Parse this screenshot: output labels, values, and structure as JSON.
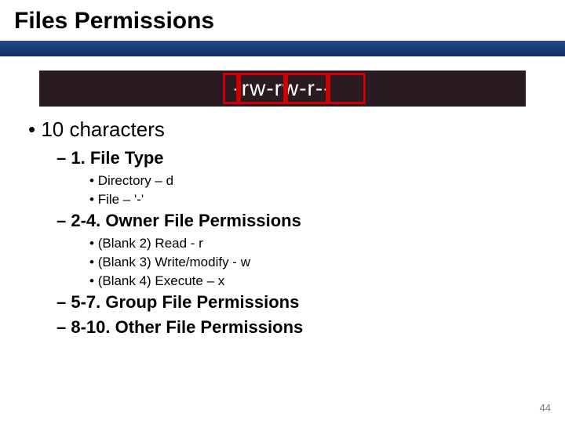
{
  "title": "Files Permissions",
  "perm_string": "-rw-rw-r--",
  "bullets": {
    "l1_1": "10 characters",
    "l2_1": "1. File Type",
    "l3_1a": "Directory – d",
    "l3_1b": "File – '-'",
    "l2_2": "2-4. Owner File Permissions",
    "l3_2a": "(Blank 2) Read - r",
    "l3_2b": "(Blank 3) Write/modify - w",
    "l3_2c": "(Blank 4) Execute – x",
    "l2_3": "5-7. Group File Permissions",
    "l2_4": "8-10. Other File Permissions"
  },
  "page_number": "44"
}
